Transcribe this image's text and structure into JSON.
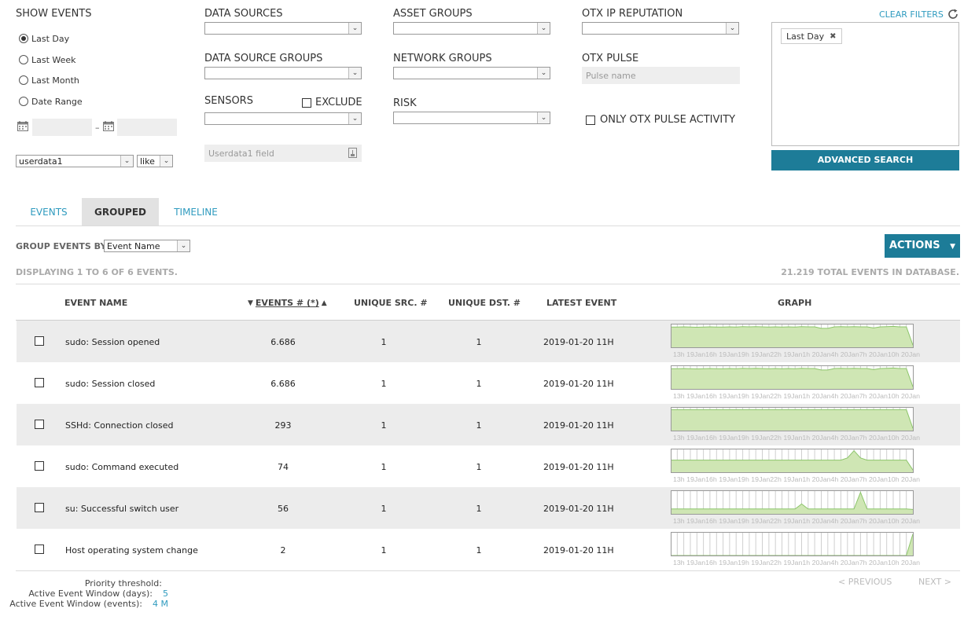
{
  "filters": {
    "show_events": {
      "title": "SHOW EVENTS",
      "options": [
        "Last Day",
        "Last Week",
        "Last Month",
        "Date Range"
      ],
      "selected": "Last Day"
    },
    "userdata_field": {
      "value": "userdata1",
      "operator": "like",
      "placeholder": "Userdata1 field"
    },
    "data_sources": {
      "label": "DATA SOURCES",
      "value": ""
    },
    "data_source_groups": {
      "label": "DATA SOURCE GROUPS",
      "value": ""
    },
    "sensors": {
      "label": "SENSORS",
      "value": "",
      "exclude_label": "EXCLUDE"
    },
    "asset_groups": {
      "label": "ASSET GROUPS",
      "value": ""
    },
    "network_groups": {
      "label": "NETWORK GROUPS",
      "value": ""
    },
    "risk": {
      "label": "RISK",
      "value": ""
    },
    "otx_ip_reputation": {
      "label": "OTX IP REPUTATION",
      "value": ""
    },
    "otx_pulse": {
      "label": "OTX PULSE",
      "placeholder": "Pulse name"
    },
    "only_otx_label": "ONLY OTX PULSE ACTIVITY",
    "clear_filters": "CLEAR FILTERS",
    "active_filter_tag": "Last Day",
    "advanced_search": "ADVANCED SEARCH"
  },
  "tabs": [
    {
      "label": "EVENTS",
      "active": false
    },
    {
      "label": "GROUPED",
      "active": true
    },
    {
      "label": "TIMELINE",
      "active": false
    }
  ],
  "group_by": {
    "label": "GROUP EVENTS BY",
    "value": "Event Name"
  },
  "actions_label": "ACTIONS",
  "displaying": "DISPLAYING 1 TO 6 OF 6 EVENTS.",
  "total_events": "21.219 TOTAL EVENTS IN DATABASE.",
  "table": {
    "columns": [
      "EVENT NAME",
      "EVENTS # (*)",
      "UNIQUE SRC. #",
      "UNIQUE DST. #",
      "LATEST EVENT",
      "GRAPH"
    ],
    "graph_labels": "13h 19Jan16h 19Jan19h 19Jan22h 19Jan1h 20Jan4h 20Jan7h 20Jan10h 20Jan",
    "rows": [
      {
        "name": "sudo: Session opened",
        "count": "6.686",
        "src": "1",
        "dst": "1",
        "latest": "2019-01-20 11H",
        "graph": [
          0.92,
          0.92,
          0.93,
          0.92,
          0.91,
          0.92,
          0.93,
          0.92,
          0.92,
          0.93,
          0.92,
          0.94,
          0.93,
          0.94,
          0.93,
          0.92,
          0.93,
          0.92,
          0.93,
          0.92,
          0.94,
          0.93,
          0.93,
          0.86,
          0.86,
          0.93,
          0.94,
          0.93,
          0.94,
          0.93,
          0.93,
          0.88,
          0.93,
          0.94,
          0.95,
          0.93,
          0.93,
          0.1
        ]
      },
      {
        "name": "sudo: Session closed",
        "count": "6.686",
        "src": "1",
        "dst": "1",
        "latest": "2019-01-20 11H",
        "graph": [
          0.92,
          0.92,
          0.93,
          0.92,
          0.91,
          0.92,
          0.93,
          0.92,
          0.92,
          0.93,
          0.92,
          0.94,
          0.93,
          0.94,
          0.93,
          0.92,
          0.93,
          0.92,
          0.93,
          0.92,
          0.94,
          0.93,
          0.93,
          0.86,
          0.86,
          0.93,
          0.94,
          0.93,
          0.94,
          0.93,
          0.93,
          0.88,
          0.93,
          0.94,
          0.95,
          0.93,
          0.93,
          0.1
        ]
      },
      {
        "name": "SSHd: Connection closed",
        "count": "293",
        "src": "1",
        "dst": "1",
        "latest": "2019-01-20 11H",
        "graph": [
          0.95,
          0.95,
          0.95,
          0.95,
          0.95,
          0.95,
          0.95,
          0.95,
          0.95,
          0.95,
          0.95,
          0.95,
          0.95,
          0.95,
          0.95,
          0.95,
          0.95,
          0.95,
          0.95,
          0.95,
          0.95,
          0.95,
          0.95,
          0.95,
          0.95,
          0.95,
          0.95,
          0.95,
          0.95,
          0.95,
          0.95,
          0.95,
          0.95,
          0.95,
          0.95,
          0.95,
          0.95,
          0.1
        ]
      },
      {
        "name": "sudo: Command executed",
        "count": "74",
        "src": "1",
        "dst": "1",
        "latest": "2019-01-20 11H",
        "graph": [
          0.55,
          0.55,
          0.55,
          0.55,
          0.55,
          0.55,
          0.55,
          0.55,
          0.55,
          0.55,
          0.55,
          0.55,
          0.55,
          0.55,
          0.55,
          0.55,
          0.55,
          0.55,
          0.55,
          0.55,
          0.55,
          0.55,
          0.55,
          0.55,
          0.55,
          0.55,
          0.55,
          0.65,
          0.98,
          0.65,
          0.55,
          0.55,
          0.55,
          0.55,
          0.55,
          0.55,
          0.55,
          0.1
        ]
      },
      {
        "name": "su: Successful switch user",
        "count": "56",
        "src": "1",
        "dst": "1",
        "latest": "2019-01-20 11H",
        "graph": [
          0.22,
          0.22,
          0.22,
          0.22,
          0.22,
          0.22,
          0.22,
          0.22,
          0.22,
          0.22,
          0.22,
          0.22,
          0.22,
          0.22,
          0.22,
          0.22,
          0.22,
          0.22,
          0.22,
          0.22,
          0.45,
          0.22,
          0.22,
          0.22,
          0.22,
          0.22,
          0.22,
          0.22,
          0.22,
          0.98,
          0.22,
          0.22,
          0.22,
          0.22,
          0.22,
          0.22,
          0.22,
          0.2
        ]
      },
      {
        "name": "Host operating system change",
        "count": "2",
        "src": "1",
        "dst": "1",
        "latest": "2019-01-20 11H",
        "graph": [
          0,
          0,
          0,
          0,
          0,
          0,
          0,
          0,
          0,
          0,
          0,
          0,
          0,
          0,
          0,
          0,
          0,
          0,
          0,
          0,
          0,
          0,
          0,
          0,
          0,
          0,
          0,
          0,
          0,
          0,
          0,
          0,
          0,
          0,
          0,
          0,
          0,
          0.98
        ]
      }
    ]
  },
  "pagination": {
    "previous": "< PREVIOUS",
    "next": "NEXT >"
  },
  "footer": {
    "priority_threshold": "Priority threshold:",
    "active_window_days_label": "Active Event Window (days):",
    "active_window_days_value": "5",
    "active_window_events_label": "Active Event Window (events):",
    "active_window_events_value": "4 M"
  },
  "colors": {
    "accent": "#1d7c98",
    "link": "#2f9bbf",
    "graph_fill": "#cfe6b4",
    "graph_stroke": "#8cc56a"
  }
}
